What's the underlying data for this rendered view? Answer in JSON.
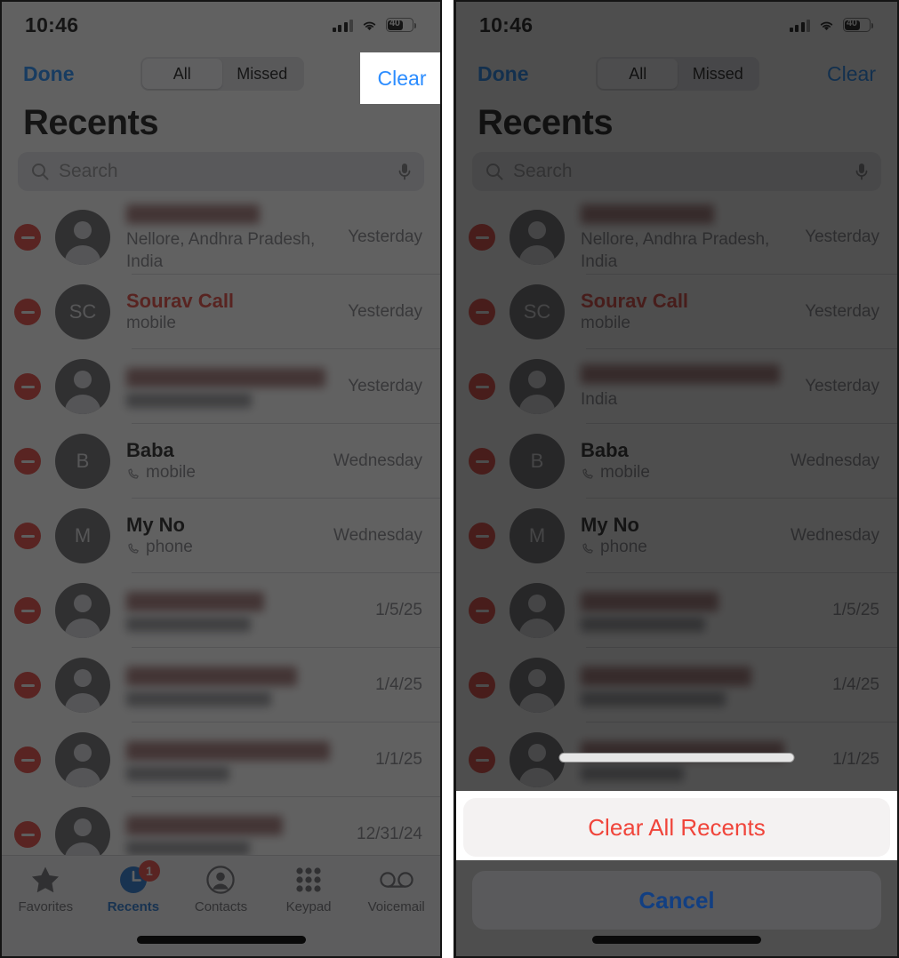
{
  "status_bar": {
    "time": "10:46",
    "battery_level": "40",
    "cellular_icon": "cellular-bars-icon",
    "wifi_icon": "wifi-icon",
    "battery_icon": "battery-icon"
  },
  "nav": {
    "done_label": "Done",
    "clear_label": "Clear",
    "segments": [
      {
        "label": "All",
        "selected": true
      },
      {
        "label": "Missed",
        "selected": false
      }
    ]
  },
  "page": {
    "title": "Recents"
  },
  "search": {
    "placeholder": "Search",
    "search_icon": "search-icon",
    "mic_icon": "microphone-icon"
  },
  "calls_left": [
    {
      "name": "",
      "redacted": true,
      "subtitle": "Nellore, Andhra Pradesh, India",
      "subtitle_redacted": false,
      "date": "Yesterday",
      "missed": false,
      "initials": "",
      "has_call_icon": false
    },
    {
      "name": "Sourav Call",
      "redacted": false,
      "subtitle": "mobile",
      "subtitle_redacted": false,
      "date": "Yesterday",
      "missed": true,
      "initials": "SC",
      "has_call_icon": false
    },
    {
      "name": "",
      "redacted": true,
      "subtitle": "",
      "subtitle_redacted": true,
      "date": "Yesterday",
      "missed": false,
      "initials": "",
      "has_call_icon": false
    },
    {
      "name": "Baba",
      "redacted": false,
      "subtitle": "mobile",
      "subtitle_redacted": false,
      "date": "Wednesday",
      "missed": false,
      "initials": "B",
      "has_call_icon": true
    },
    {
      "name": "My No",
      "redacted": false,
      "subtitle": "phone",
      "subtitle_redacted": false,
      "date": "Wednesday",
      "missed": false,
      "initials": "M",
      "has_call_icon": true
    },
    {
      "name": "",
      "redacted": true,
      "subtitle": "",
      "subtitle_redacted": true,
      "date": "1/5/25",
      "missed": false,
      "initials": "",
      "has_call_icon": false
    },
    {
      "name": "",
      "redacted": true,
      "subtitle": "",
      "subtitle_redacted": true,
      "date": "1/4/25",
      "missed": false,
      "initials": "",
      "has_call_icon": false
    },
    {
      "name": "",
      "redacted": true,
      "subtitle": "",
      "subtitle_redacted": true,
      "date": "1/1/25",
      "missed": false,
      "initials": "",
      "has_call_icon": false
    },
    {
      "name": "",
      "redacted": true,
      "subtitle": "",
      "subtitle_redacted": true,
      "date": "12/31/24",
      "missed": false,
      "initials": "",
      "has_call_icon": false
    }
  ],
  "calls_right": [
    {
      "name": "",
      "redacted": true,
      "subtitle": "Nellore, Andhra Pradesh, India",
      "subtitle_redacted": false,
      "date": "Yesterday",
      "missed": false,
      "initials": "",
      "has_call_icon": false
    },
    {
      "name": "Sourav Call",
      "redacted": false,
      "subtitle": "mobile",
      "subtitle_redacted": false,
      "date": "Yesterday",
      "missed": true,
      "initials": "SC",
      "has_call_icon": false
    },
    {
      "name": "",
      "redacted": true,
      "subtitle": "India",
      "subtitle_redacted": false,
      "date": "Yesterday",
      "missed": false,
      "initials": "",
      "has_call_icon": false
    },
    {
      "name": "Baba",
      "redacted": false,
      "subtitle": "mobile",
      "subtitle_redacted": false,
      "date": "Wednesday",
      "missed": false,
      "initials": "B",
      "has_call_icon": true
    },
    {
      "name": "My No",
      "redacted": false,
      "subtitle": "phone",
      "subtitle_redacted": false,
      "date": "Wednesday",
      "missed": false,
      "initials": "M",
      "has_call_icon": true
    },
    {
      "name": "",
      "redacted": true,
      "subtitle": "",
      "subtitle_redacted": true,
      "date": "1/5/25",
      "missed": false,
      "initials": "",
      "has_call_icon": false
    },
    {
      "name": "",
      "redacted": true,
      "subtitle": "",
      "subtitle_redacted": true,
      "date": "1/4/25",
      "missed": false,
      "initials": "",
      "has_call_icon": false
    },
    {
      "name": "",
      "redacted": true,
      "subtitle": "",
      "subtitle_redacted": true,
      "date": "1/1/25",
      "missed": false,
      "initials": "",
      "has_call_icon": false
    }
  ],
  "tabbar": [
    {
      "label": "Favorites",
      "icon": "star-icon",
      "active": false,
      "badge": ""
    },
    {
      "label": "Recents",
      "icon": "clock-icon",
      "active": true,
      "badge": "1"
    },
    {
      "label": "Contacts",
      "icon": "person-circle-icon",
      "active": false,
      "badge": ""
    },
    {
      "label": "Keypad",
      "icon": "keypad-icon",
      "active": false,
      "badge": ""
    },
    {
      "label": "Voicemail",
      "icon": "voicemail-icon",
      "active": false,
      "badge": ""
    }
  ],
  "action_sheet": {
    "destructive_label": "Clear All Recents",
    "cancel_label": "Cancel"
  },
  "colors": {
    "accent_blue": "#0a84ff",
    "highlight_blue": "#2b8cff",
    "destructive_red": "#f0453b",
    "missed_red": "#e0342a",
    "minus_red": "#e4352c",
    "cancel_blue": "#123f82"
  }
}
